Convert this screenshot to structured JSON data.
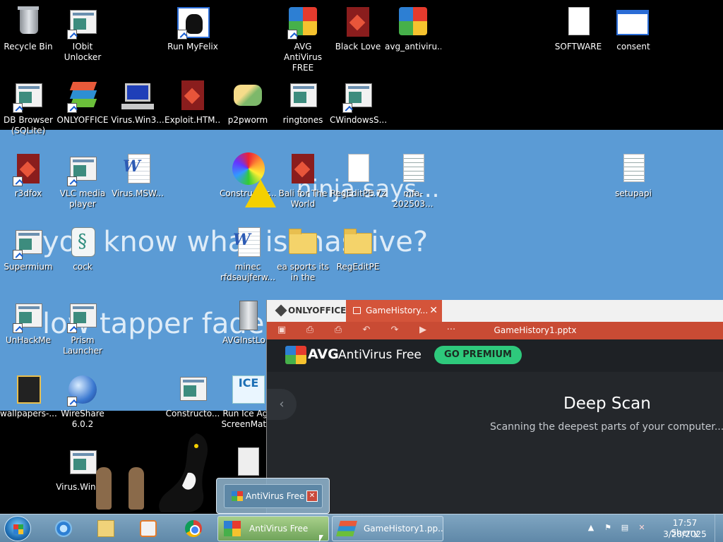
{
  "desktop": {
    "slide_text": {
      "line1": "ninja says...",
      "line2": "you know what is massive?",
      "line3": "low tapper fade ("
    },
    "icons": [
      {
        "label": "Recycle Bin",
        "icon": "recycle-bin-icon"
      },
      {
        "label": "IObit Unlocker",
        "icon": "app-icon"
      },
      {
        "label": "Run MyFelix",
        "icon": "cat-icon"
      },
      {
        "label": "AVG AntiVirus FREE",
        "icon": "avg-icon"
      },
      {
        "label": "Black Love",
        "icon": "red-file-icon"
      },
      {
        "label": "avg_antiviru...",
        "icon": "avg-icon"
      },
      {
        "label": "SOFTWARE",
        "icon": "file-icon"
      },
      {
        "label": "consent",
        "icon": "window-icon"
      },
      {
        "label": "DB Browser (SQLite)",
        "icon": "app-icon"
      },
      {
        "label": "ONLYOFFICE",
        "icon": "onlyoffice-icon"
      },
      {
        "label": "Virus.Win3...",
        "icon": "computer-icon"
      },
      {
        "label": "Exploit.HTM...",
        "icon": "red-file-icon"
      },
      {
        "label": "p2pworm",
        "icon": "handshake-icon"
      },
      {
        "label": "ringtones",
        "icon": "app-icon"
      },
      {
        "label": "CWindowsS...",
        "icon": "app-icon"
      },
      {
        "label": "r3dfox",
        "icon": "red-file-icon"
      },
      {
        "label": "VLC media player",
        "icon": "app-icon"
      },
      {
        "label": "Virus.MSW...",
        "icon": "word-doc-icon"
      },
      {
        "label": "Constructor...",
        "icon": "swirl-icon"
      },
      {
        "label": "Bali for The World",
        "icon": "red-file-icon"
      },
      {
        "label": "RegEditPE.7z",
        "icon": "file-icon"
      },
      {
        "label": "mfa-202503...",
        "icon": "text-file-icon"
      },
      {
        "label": "setupapi",
        "icon": "text-file-icon"
      },
      {
        "label": "Supermium",
        "icon": "app-icon"
      },
      {
        "label": "cock",
        "icon": "script-icon"
      },
      {
        "label": "minec rfdsaujferw...",
        "icon": "word-doc-icon"
      },
      {
        "label": "ea sports its in the",
        "icon": "folder-icon"
      },
      {
        "label": "RegEditPE",
        "icon": "folder-icon"
      },
      {
        "label": "UnHackMe",
        "icon": "app-icon"
      },
      {
        "label": "Prism Launcher",
        "icon": "app-icon"
      },
      {
        "label": "AVGInstLo...",
        "icon": "server-icon"
      },
      {
        "label": "wallpapers-...",
        "icon": "dark-folder-icon"
      },
      {
        "label": "WireShare 6.0.2",
        "icon": "globe-icon"
      },
      {
        "label": "Constructo...",
        "icon": "window-icon"
      },
      {
        "label": "Run Ice Age ScreenMat...",
        "icon": "ice-icon"
      },
      {
        "label": "Virus.Win3...",
        "icon": "app-icon"
      }
    ]
  },
  "onlyoffice": {
    "brand": "ONLYOFFICE",
    "tab_label": "GameHistory...",
    "tab_close": "✕",
    "doc_title": "GameHistory1.pptx",
    "toolbar": [
      "save-icon",
      "print-icon",
      "quick-print-icon",
      "undo-icon",
      "redo-icon",
      "play-icon",
      "more-icon"
    ],
    "accent_color": "#c94b34"
  },
  "avg_slide": {
    "brand": "AVG",
    "product": "AntiVirus Free",
    "premium_button": "GO PREMIUM",
    "back_arrow": "‹",
    "scan_title": "Deep Scan",
    "scan_subtitle": "Scanning the deepest parts of your computer...",
    "premium_color": "#2ec97c"
  },
  "thumbnail": {
    "label": "AntiVirus Free",
    "close": "✕"
  },
  "taskbar": {
    "pinned": [
      "internet-explorer-icon",
      "file-explorer-icon",
      "media-player-icon",
      "chrome-icon"
    ],
    "windows": [
      {
        "label": "AntiVirus Free",
        "icon": "avg-icon",
        "active": true
      },
      {
        "label": "GameHistory1.pp...",
        "icon": "onlyoffice-icon",
        "active": false
      }
    ],
    "tray": {
      "show_hidden": "▲",
      "time": "17:57 Sherry",
      "date": "3/28/2025"
    }
  }
}
